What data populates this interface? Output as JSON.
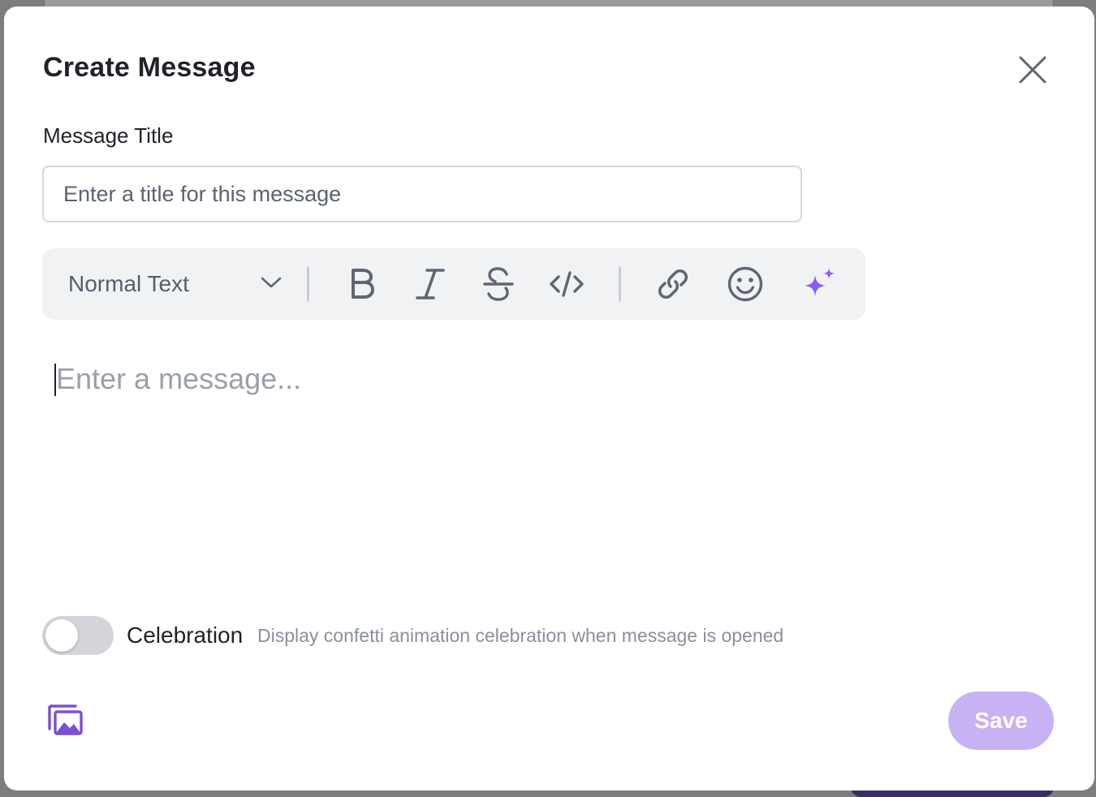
{
  "modal": {
    "title": "Create Message"
  },
  "title_field": {
    "label": "Message Title",
    "value": "",
    "placeholder": "Enter a title for this message"
  },
  "toolbar": {
    "text_style": "Normal Text",
    "buttons": [
      {
        "icon": "bold-icon"
      },
      {
        "icon": "italic-icon"
      },
      {
        "icon": "strikethrough-icon"
      },
      {
        "icon": "code-icon"
      },
      {
        "icon": "link-icon"
      },
      {
        "icon": "emoji-icon"
      },
      {
        "icon": "ai-sparkle-icon"
      }
    ]
  },
  "editor": {
    "placeholder": "Enter a message..."
  },
  "celebration": {
    "label": "Celebration",
    "description": "Display confetti animation celebration when message is opened",
    "enabled": false
  },
  "footer": {
    "media_icon": "image-gallery-icon",
    "save_label": "Save"
  },
  "colors": {
    "accent": "#8b5cf6",
    "save_disabled": "#c7b2f3",
    "icon_gray": "#5f6673"
  }
}
